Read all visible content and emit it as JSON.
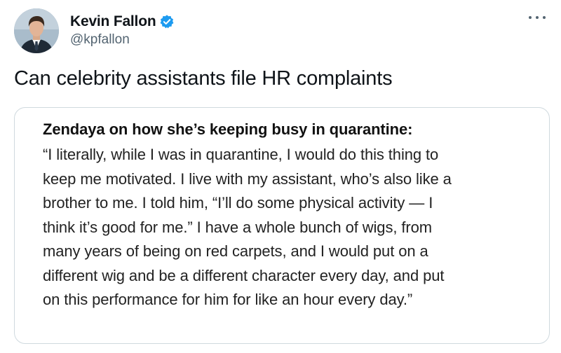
{
  "author": {
    "display_name": "Kevin Fallon",
    "handle": "@kpfallon",
    "verified": true,
    "verified_color": "#1d9bf0"
  },
  "icons": {
    "verified": "verified-badge-icon",
    "more": "more-options-icon",
    "avatar": "avatar-photo"
  },
  "tweet": {
    "text": "Can celebrity assistants file HR complaints"
  },
  "quote_image": {
    "heading": "Zendaya on how she’s keeping busy in quarantine:",
    "lines": [
      "“I literally, while I was in quarantine, I would do this thing to",
      "keep me motivated. I live with my assistant, who’s also like a",
      "brother to me. I told him, “I’ll do some physical activity — I",
      "think it’s good for me.” I have a whole bunch of wigs, from",
      "many years of being on red carpets, and I would put on a",
      "different wig and be a different character every day, and put",
      "on this performance for him for like an hour every day.”"
    ]
  },
  "colors": {
    "text": "#0f1419",
    "secondary": "#536471",
    "border": "#cfd9de"
  }
}
